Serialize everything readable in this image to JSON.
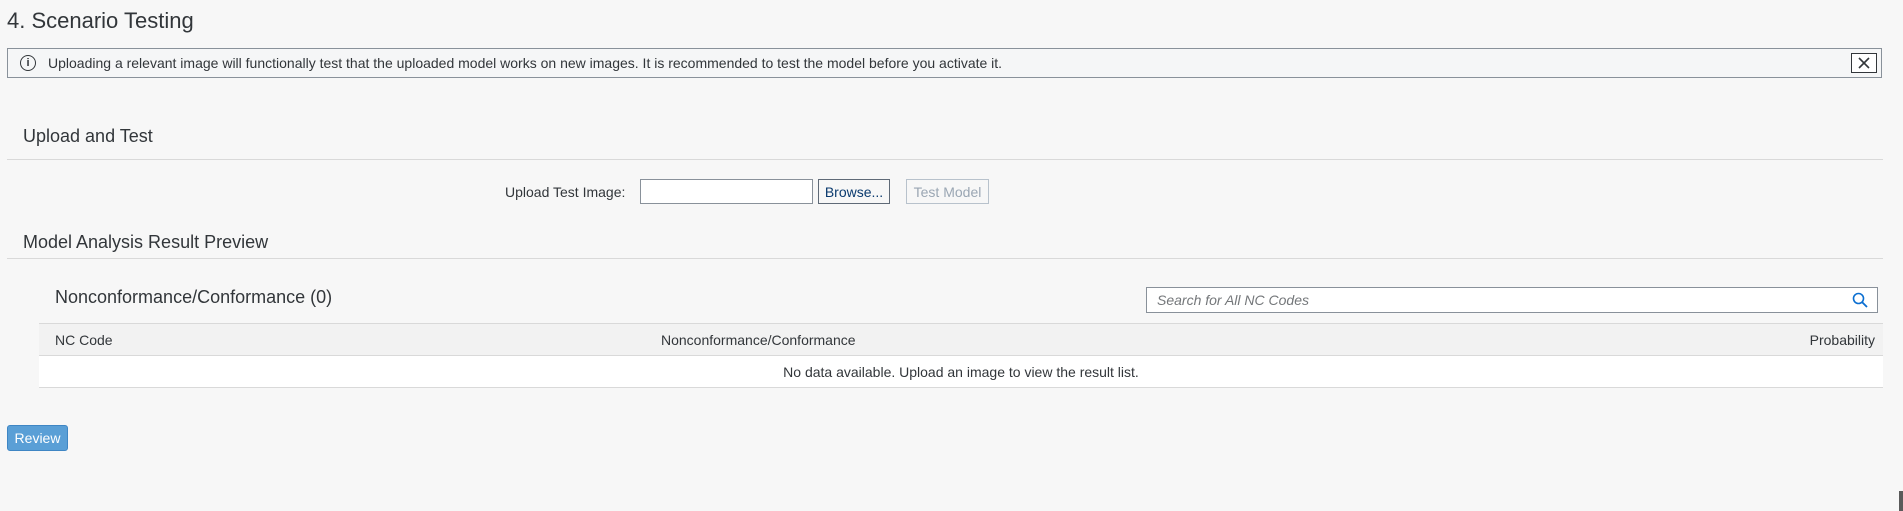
{
  "section": {
    "title": "4. Scenario Testing"
  },
  "info_strip": {
    "message": "Uploading a relevant image will functionally test that the uploaded model works on new images. It is recommended to test the model before you activate it.",
    "icon": "info-icon",
    "close_icon": "close-icon"
  },
  "upload_and_test": {
    "title": "Upload and Test",
    "label": "Upload Test Image:",
    "input_value": "",
    "browse_label": "Browse...",
    "test_model_label": "Test Model"
  },
  "result_preview": {
    "title": "Model Analysis Result Preview",
    "table_title": "Nonconformance/Conformance (0)",
    "search_placeholder": "Search for All NC Codes",
    "search_icon": "search-icon",
    "columns": [
      "NC Code",
      "Nonconformance/Conformance",
      "Probability"
    ],
    "empty_message": "No data available. Upload an image to view the result list."
  },
  "footer": {
    "review_label": "Review"
  },
  "colors": {
    "background": "#f7f7f7",
    "accent_button": "#5a9fd6",
    "text": "#32363a",
    "disabled_text": "#9aa6b3"
  }
}
